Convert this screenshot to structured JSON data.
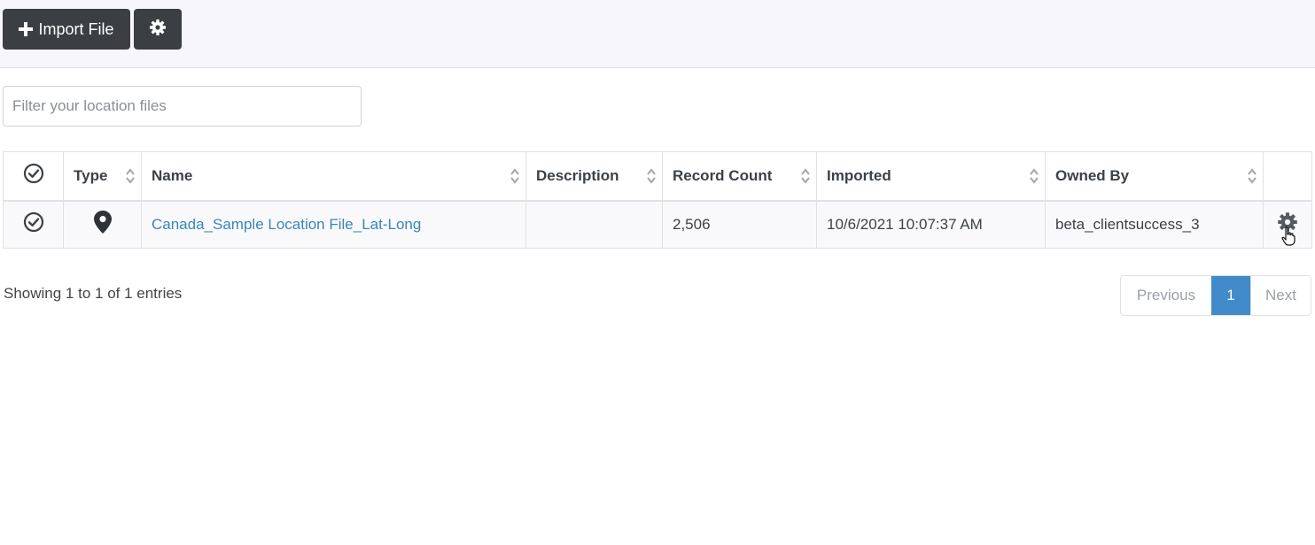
{
  "toolbar": {
    "import_label": "Import File",
    "import_icon": "plus-icon",
    "settings_icon": "gear-icon"
  },
  "filter": {
    "placeholder": "Filter your location files",
    "value": ""
  },
  "table": {
    "headers": {
      "select": "",
      "type": "Type",
      "name": "Name",
      "description": "Description",
      "record_count": "Record Count",
      "imported": "Imported",
      "owned_by": "Owned By"
    },
    "rows": [
      {
        "type_icon": "map-pin-icon",
        "name": "Canada_Sample Location File_Lat-Long",
        "description": "",
        "record_count": "2,506",
        "imported": "10/6/2021 10:07:37 AM",
        "owned_by": "beta_clientsuccess_3",
        "actions_icon": "gear-icon"
      }
    ]
  },
  "footer": {
    "info": "Showing 1 to 1 of 1 entries",
    "pagination": {
      "previous": "Previous",
      "current": "1",
      "next": "Next"
    }
  },
  "colors": {
    "toolbar_button": "#3b3e43",
    "link": "#3a87b4",
    "active_page": "#428bca"
  }
}
